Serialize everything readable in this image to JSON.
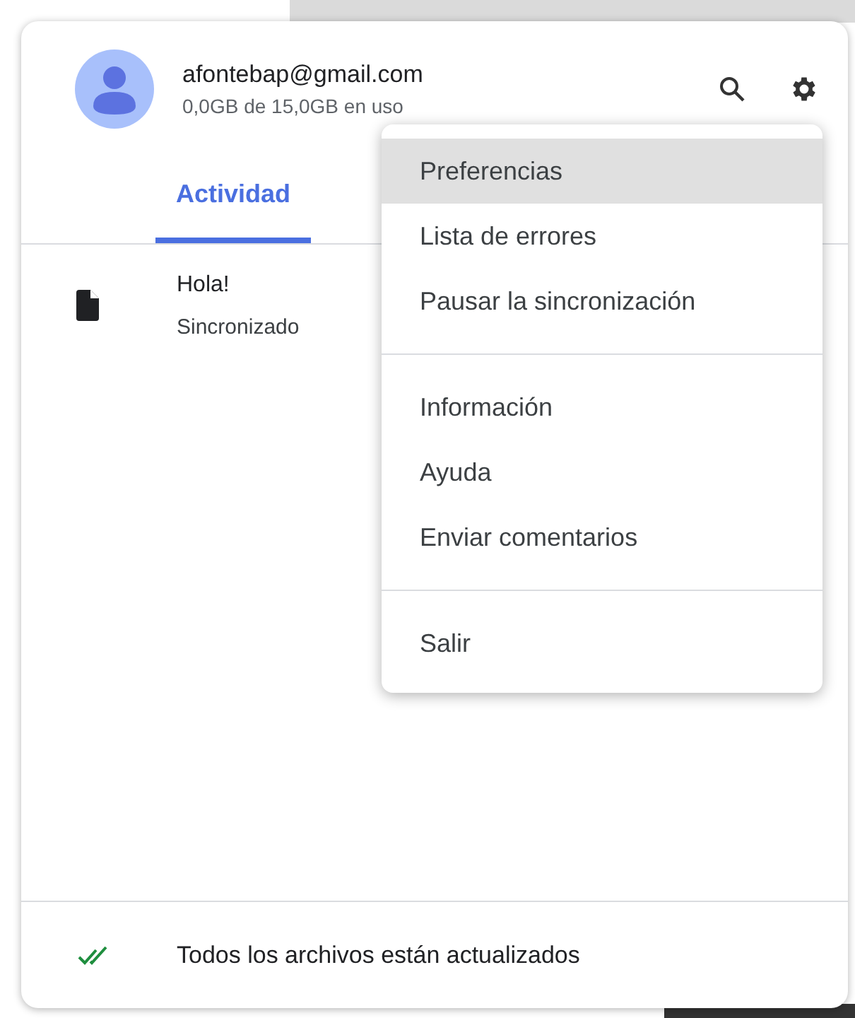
{
  "account": {
    "email": "afontebap@gmail.com",
    "storage": "0,0GB de 15,0GB en uso"
  },
  "tabs": [
    {
      "label": "Actividad",
      "selected": true
    }
  ],
  "activity": [
    {
      "name": "Hola!",
      "status": "Sincronizado"
    }
  ],
  "menu": {
    "groups": [
      [
        {
          "label": "Preferencias",
          "selected": true
        },
        {
          "label": "Lista de errores",
          "selected": false
        },
        {
          "label": "Pausar la sincronización",
          "selected": false
        }
      ],
      [
        {
          "label": "Información",
          "selected": false
        },
        {
          "label": "Ayuda",
          "selected": false
        },
        {
          "label": "Enviar comentarios",
          "selected": false
        }
      ],
      [
        {
          "label": "Salir",
          "selected": false
        }
      ]
    ]
  },
  "status_bar": {
    "text": "Todos los archivos están actualizados"
  }
}
